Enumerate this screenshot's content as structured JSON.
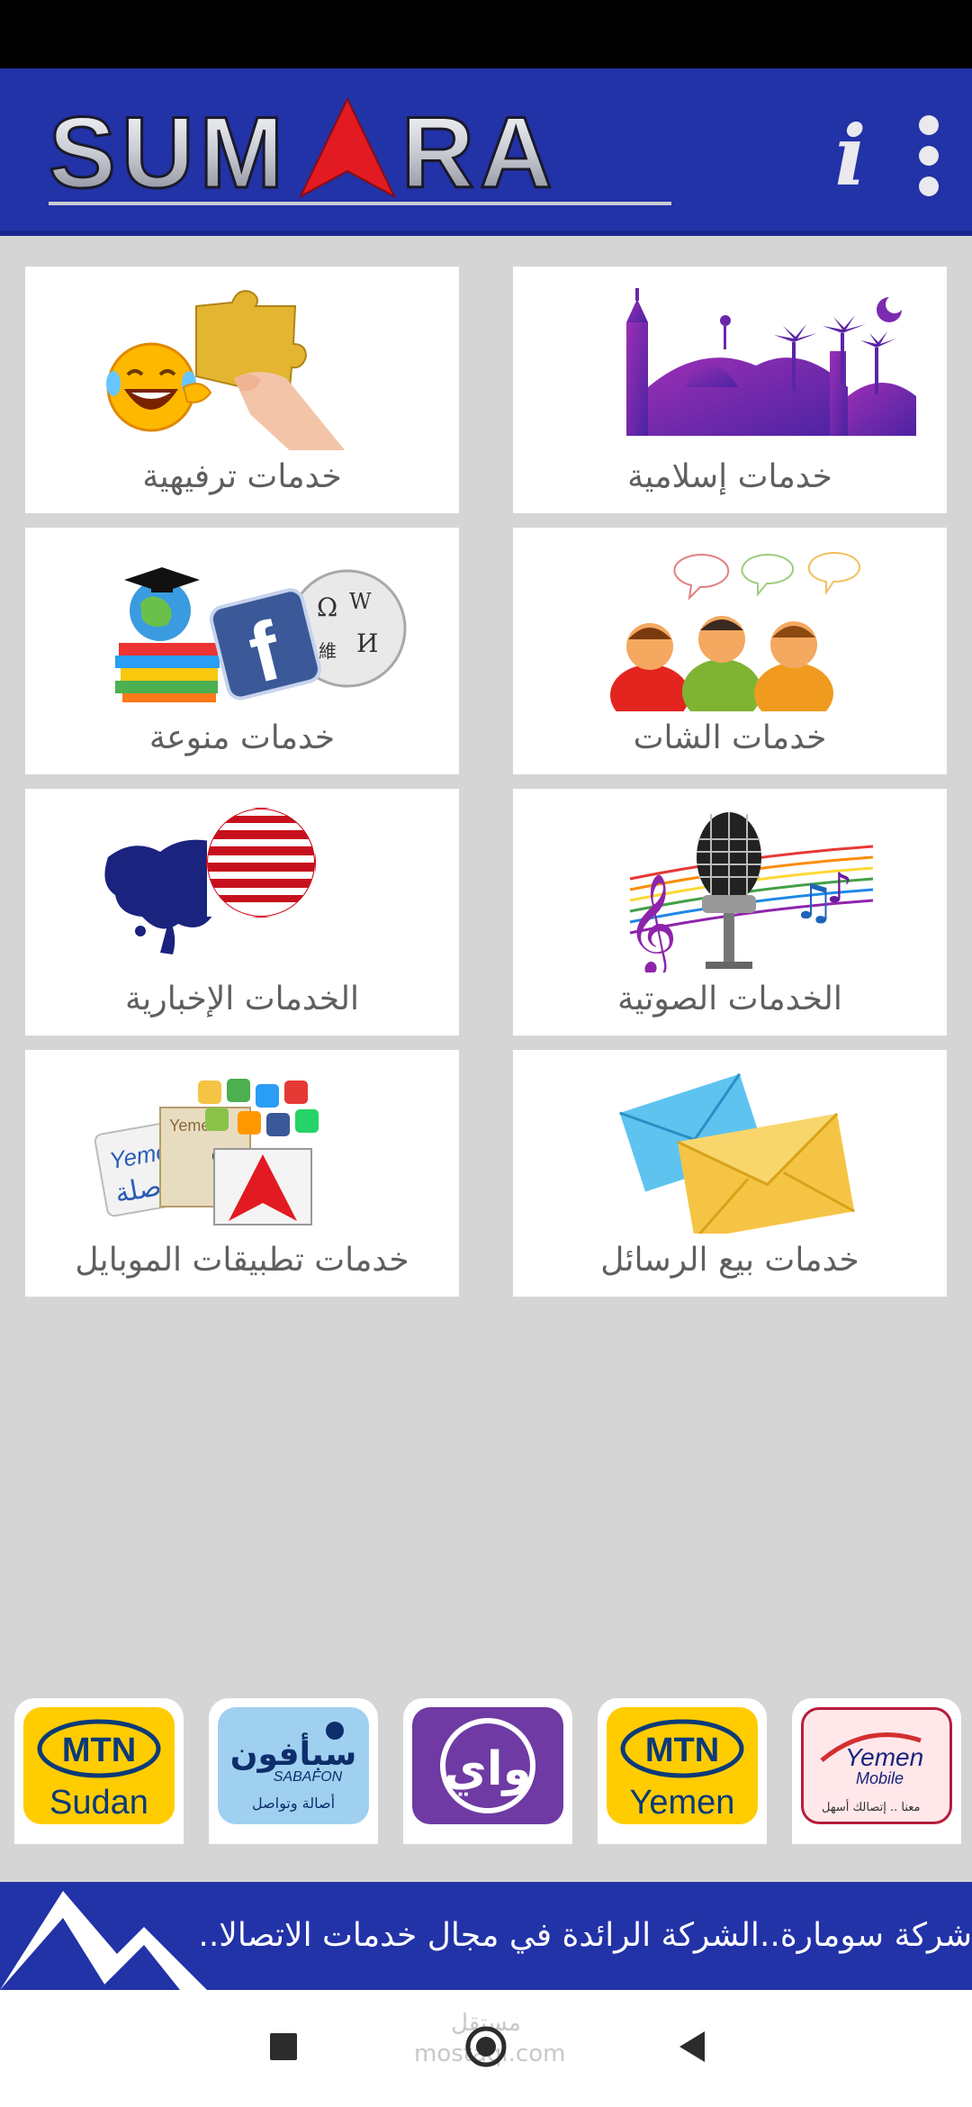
{
  "header": {
    "logo_text": "SUMARA",
    "info_label": "i"
  },
  "tiles": [
    {
      "label": "خدمات إسلامية",
      "icon": "mosque-icon"
    },
    {
      "label": "خدمات ترفيهية",
      "icon": "fun-puzzle-icon"
    },
    {
      "label": "خدمات الشات",
      "icon": "chat-people-icon"
    },
    {
      "label": "خدمات منوعة",
      "icon": "misc-globe-books-icon"
    },
    {
      "label": "الخدمات الصوتية",
      "icon": "microphone-music-icon"
    },
    {
      "label": "الخدمات الإخبارية",
      "icon": "world-news-icon"
    },
    {
      "label": "خدمات بيع الرسائل",
      "icon": "envelopes-icon"
    },
    {
      "label": "خدمات تطبيقات الموبايل",
      "icon": "mobile-apps-icon"
    }
  ],
  "operators": [
    {
      "name": "Yemen Mobile",
      "line1": "Yemen",
      "line2": "Mobile",
      "tagline": "معنا .. إتصالك أسهل"
    },
    {
      "name": "MTN Yemen",
      "line1": "MTN",
      "line2": "Yemen"
    },
    {
      "name": "واي",
      "line1": "واي"
    },
    {
      "name": "SabaFon",
      "line1": "سبأفون",
      "line2": "SABAFON",
      "tagline": "أصالة وتواصل"
    },
    {
      "name": "MTN Sudan",
      "line1": "MTN",
      "line2": "Sudan"
    }
  ],
  "ticker": {
    "text": "شركة سومارة..الشركة الرائدة في مجال خدمات الاتصالا.."
  },
  "watermark": {
    "line1": "مستقل",
    "line2": "mostaql.com"
  },
  "colors": {
    "brand_blue": "#2232a7",
    "brand_red": "#e21a22",
    "background": "#d5d5d5",
    "mtn_yellow": "#ffcc00"
  }
}
